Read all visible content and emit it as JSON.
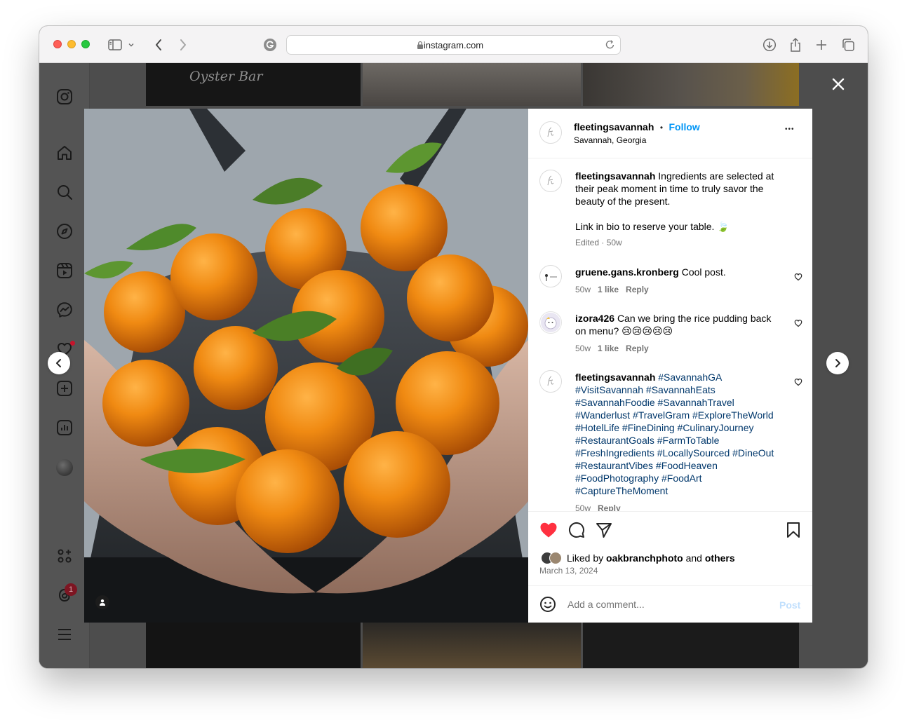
{
  "browser": {
    "url": "instagram.com"
  },
  "background": {
    "tile_caption": "Oyster Bar"
  },
  "post": {
    "author": "fleetingsavannah",
    "follow_label": "Follow",
    "separator": "•",
    "location": "Savannah, Georgia",
    "more_label": "•••",
    "caption_author": "fleetingsavannah",
    "caption_line1": "Ingredients are selected at",
    "caption_line2": "their peak moment in time to truly savor the",
    "caption_line3": "beauty of the present.",
    "caption_line4": "Link in bio to reserve your table. 🍃",
    "caption_meta": "Edited · 50w",
    "comments": [
      {
        "user": "gruene.gans.kronberg",
        "text": "Cool post.",
        "age": "50w",
        "likes": "1 like",
        "reply": "Reply"
      },
      {
        "user": "izora426",
        "text_line1": "Can we bring the rice pudding back",
        "text_line2": "on menu? 😢😢😢😢😢",
        "age": "50w",
        "likes": "1 like",
        "reply": "Reply"
      },
      {
        "user": "fleetingsavannah",
        "hashtag_lines": [
          "#SavannahGA",
          "#VisitSavannah #SavannahEats",
          "#SavannahFoodie #SavannahTravel",
          "#Wanderlust #TravelGram #ExploreTheWorld",
          "#HotelLife #FineDining #CulinaryJourney",
          "#RestaurantGoals #FarmToTable",
          "#FreshIngredients #LocallySourced #DineOut",
          "#RestaurantVibes #FoodHeaven",
          "#FoodPhotography #FoodArt",
          "#CaptureTheMoment"
        ],
        "age": "50w",
        "reply": "Reply"
      }
    ],
    "liked_by_prefix": "Liked by",
    "liked_by_user": "oakbranchphoto",
    "liked_by_and": "and",
    "liked_by_others": "others",
    "date": "March 13, 2024",
    "comment_placeholder": "Add a comment...",
    "post_label": "Post",
    "liked": true
  },
  "sidebar": {
    "notifications_badge": "1"
  },
  "colors": {
    "accent": "#0095f6",
    "heart": "#ff3040",
    "hashtag": "#00376b",
    "overlay": "#4d4d4d"
  }
}
